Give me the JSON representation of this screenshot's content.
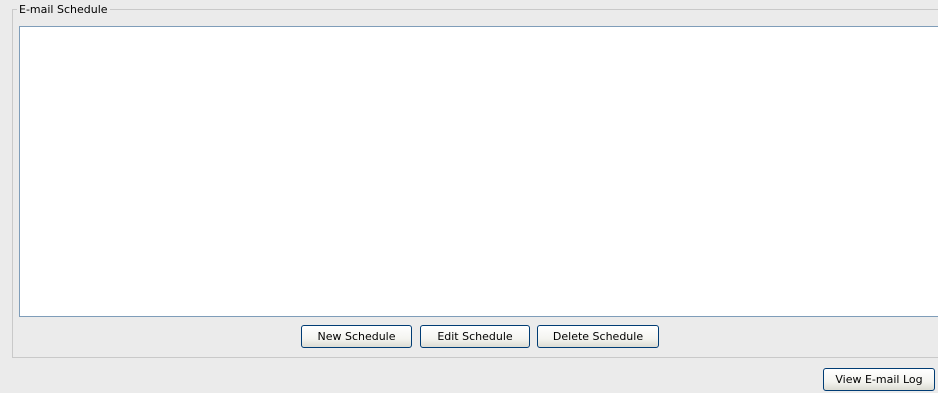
{
  "email_schedule": {
    "group_title": "E-mail Schedule",
    "buttons": {
      "new_schedule": "New Schedule",
      "edit_schedule": "Edit Schedule",
      "delete_schedule": "Delete Schedule"
    }
  },
  "footer": {
    "view_log_label": "View E-mail Log"
  }
}
